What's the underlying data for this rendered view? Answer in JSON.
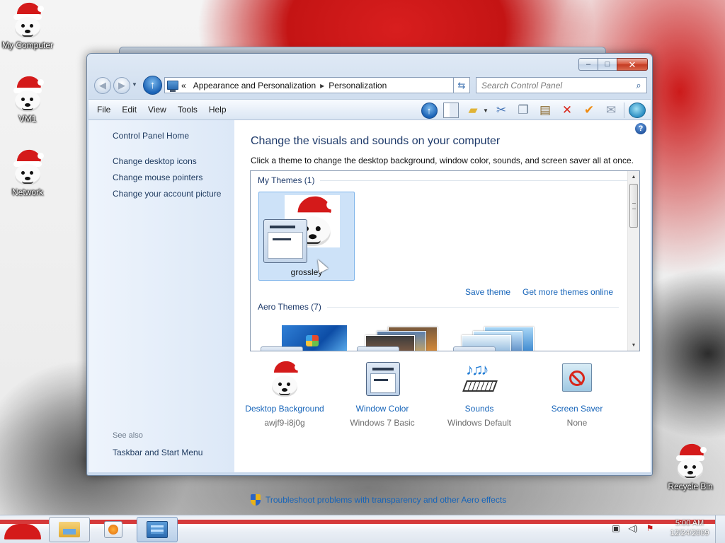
{
  "desktop": {
    "icons": [
      {
        "label": "My Computer"
      },
      {
        "label": "VM1"
      },
      {
        "label": "Network"
      },
      {
        "label": "Recycle Bin"
      }
    ]
  },
  "window": {
    "caption": {
      "minimize": "–",
      "maximize": "□",
      "close": "✕"
    },
    "address": {
      "prefix": "«",
      "crumbs": [
        "Appearance and Personalization",
        "Personalization"
      ],
      "separator": "▸"
    },
    "search": {
      "placeholder": "Search Control Panel"
    },
    "menu": [
      "File",
      "Edit",
      "View",
      "Tools",
      "Help"
    ],
    "toolbar_icons": [
      "up-icon",
      "pane-icon",
      "folder-check-icon",
      "cut-icon",
      "copy-icon",
      "paste-icon",
      "delete-icon",
      "checkmark-icon",
      "email-icon",
      "globe-icon"
    ]
  },
  "left_pane": {
    "home": "Control Panel Home",
    "links": [
      "Change desktop icons",
      "Change mouse pointers",
      "Change your account picture"
    ],
    "see_also": "See also",
    "see_also_links": [
      "Taskbar and Start Menu"
    ]
  },
  "main": {
    "title": "Change the visuals and sounds on your computer",
    "description": "Click a theme to change the desktop background, window color, sounds, and screen saver all at once.",
    "my_themes_header": "My Themes (1)",
    "selected_theme": "grossley",
    "save_theme": "Save theme",
    "more_themes": "Get more themes online",
    "aero_themes_header": "Aero Themes (7)",
    "settings": [
      {
        "label": "Desktop Background",
        "value": "awjf9-i8j0g"
      },
      {
        "label": "Window Color",
        "value": "Windows 7 Basic"
      },
      {
        "label": "Sounds",
        "value": "Windows Default"
      },
      {
        "label": "Screen Saver",
        "value": "None"
      }
    ],
    "troubleshoot": "Troubleshoot problems with transparency and other Aero effects"
  },
  "taskbar": {
    "clock_time": "5:00 AM",
    "clock_date": "12/24/2009"
  },
  "colors": {
    "link": "#1664b9",
    "heading": "#1e3a6a",
    "santa_red": "#d41a1a",
    "selected_tile": "#cde2f8"
  }
}
